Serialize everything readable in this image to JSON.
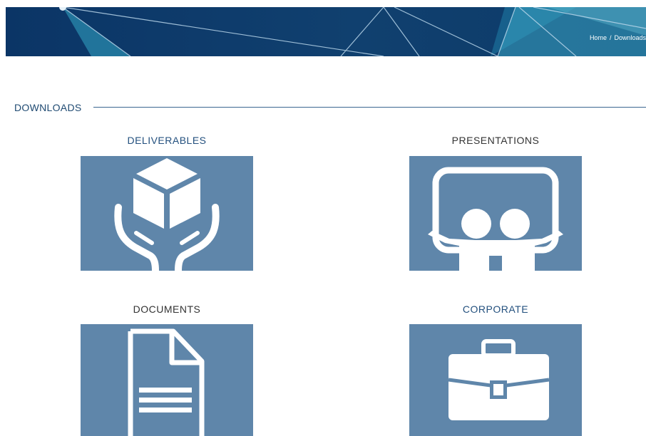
{
  "breadcrumb": {
    "home": "Home",
    "separator": "/",
    "current": "Downloads"
  },
  "section": {
    "title": "DOWNLOADS"
  },
  "cards": [
    {
      "title": "DELIVERABLES",
      "icon": "box-in-hands-icon"
    },
    {
      "title": "PRESENTATIONS",
      "icon": "presentation-board-icon"
    },
    {
      "title": "DOCUMENTS",
      "icon": "document-icon"
    },
    {
      "title": "CORPORATE",
      "icon": "briefcase-icon"
    }
  ],
  "colors": {
    "hero_background": "#0f3c6e",
    "tile_background": "#5f86aa",
    "heading_blue": "#23507e",
    "heading_dark": "#333333"
  }
}
